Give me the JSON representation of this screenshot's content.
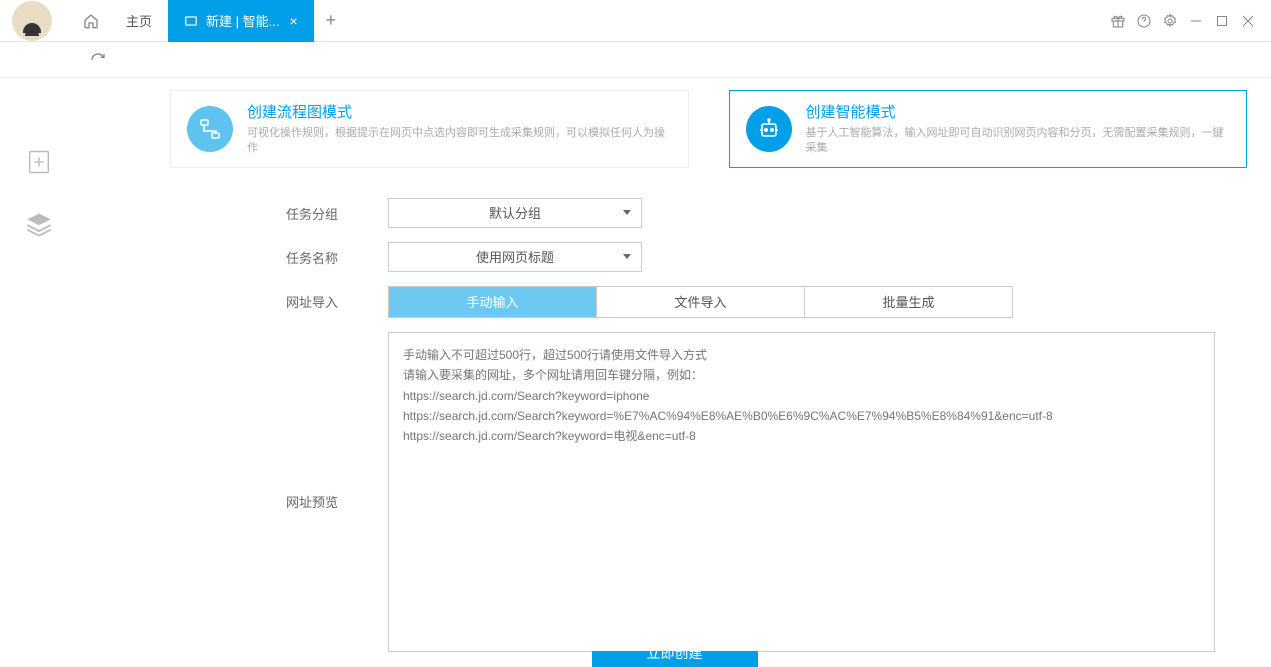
{
  "titlebar": {
    "home_tab": "主页",
    "active_tab": "新建 | 智能...",
    "add": "+"
  },
  "mode_cards": {
    "flowchart": {
      "title": "创建流程图模式",
      "desc": "可视化操作规则，根据提示在网页中点选内容即可生成采集规则，可以模拟任何人为操作"
    },
    "smart": {
      "title": "创建智能模式",
      "desc": "基于人工智能算法，输入网址即可自动识别网页内容和分页，无需配置采集规则，一键采集"
    }
  },
  "form": {
    "group_label": "任务分组",
    "group_value": "默认分组",
    "name_label": "任务名称",
    "name_value": "使用网页标题",
    "url_import_label": "网址导入",
    "url_preview_label": "网址预览",
    "url_tabs": {
      "manual": "手动输入",
      "file": "文件导入",
      "batch": "批量生成"
    },
    "textarea_placeholder": "手动输入不可超过500行，超过500行请使用文件导入方式\n请输入要采集的网址，多个网址请用回车键分隔，例如：\nhttps://search.jd.com/Search?keyword=iphone\nhttps://search.jd.com/Search?keyword=%E7%AC%94%E8%AE%B0%E6%9C%AC%E7%94%B5%E8%84%91&enc=utf-8\nhttps://search.jd.com/Search?keyword=电视&enc=utf-8"
  },
  "create_button": "立即创建"
}
